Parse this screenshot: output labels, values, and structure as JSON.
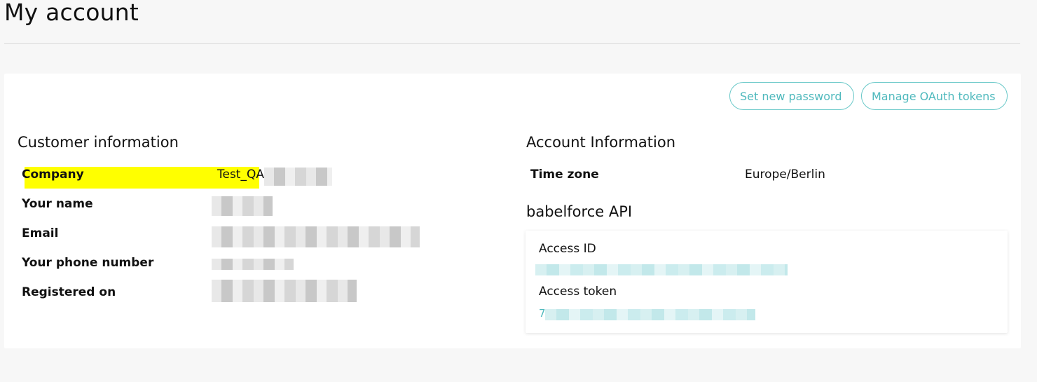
{
  "page": {
    "title": "My account"
  },
  "buttons": {
    "set_password": "Set new password",
    "manage_oauth": "Manage OAuth tokens"
  },
  "customer_info": {
    "title": "Customer information",
    "rows": [
      {
        "label": "Company",
        "value": "Test_QA"
      },
      {
        "label": "Your name",
        "value": ""
      },
      {
        "label": "Email",
        "value": ""
      },
      {
        "label": "Your phone number",
        "value": ""
      },
      {
        "label": "Registered on",
        "value": ""
      }
    ]
  },
  "account_info": {
    "title": "Account Information",
    "timezone_label": "Time zone",
    "timezone_value": "Europe/Berlin"
  },
  "api": {
    "title": "babelforce API",
    "access_id_label": "Access ID",
    "access_token_label": "Access token",
    "access_token_prefix": "7"
  },
  "colors": {
    "accent": "#4fb9bd",
    "highlight": "#ffff00",
    "background": "#f7f7f7"
  }
}
